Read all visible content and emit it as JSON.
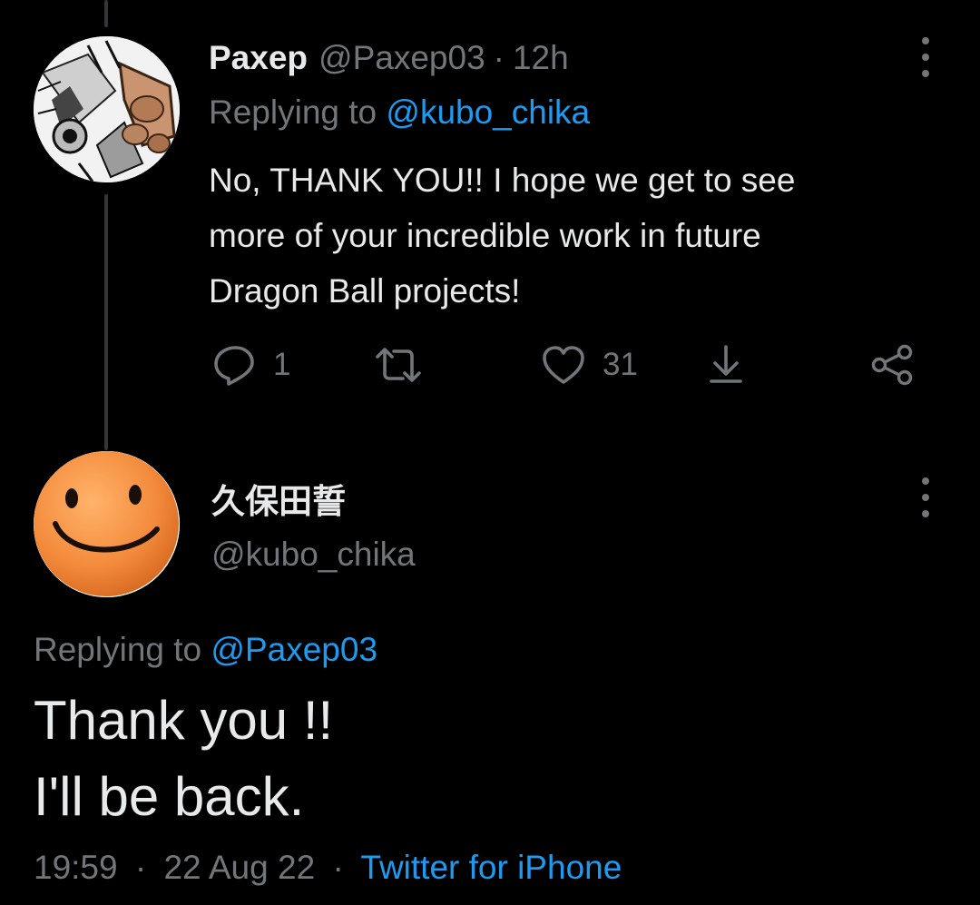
{
  "colors": {
    "background": "#000000",
    "text_primary": "#e7e9ea",
    "text_secondary": "#71767b",
    "accent": "#1d9bf0"
  },
  "parent_tweet": {
    "author_name": "Paxep",
    "author_handle": "@Paxep03",
    "separator": "·",
    "age": "12h",
    "replying_prefix": "Replying to",
    "replying_to": "@kubo_chika",
    "text_lines": [
      "No, THANK YOU!! I hope we get to see",
      "more of your incredible work in future",
      "Dragon Ball projects!"
    ],
    "actions": {
      "reply_icon": "reply-icon",
      "reply_count": "1",
      "retweet_icon": "retweet-icon",
      "like_icon": "heart-icon",
      "like_count": "31",
      "download_icon": "download-icon",
      "share_icon": "share-icon"
    },
    "more_icon": "more-vertical-icon"
  },
  "main_tweet": {
    "author_name": "久保田誓",
    "author_handle": "@kubo_chika",
    "replying_prefix": "Replying to",
    "replying_to": "@Paxep03",
    "text_lines": [
      "Thank you !!",
      "I'll be back."
    ],
    "time": "19:59",
    "separator": "·",
    "date": "22 Aug 22",
    "source": "Twitter for iPhone",
    "more_icon": "more-vertical-icon"
  }
}
